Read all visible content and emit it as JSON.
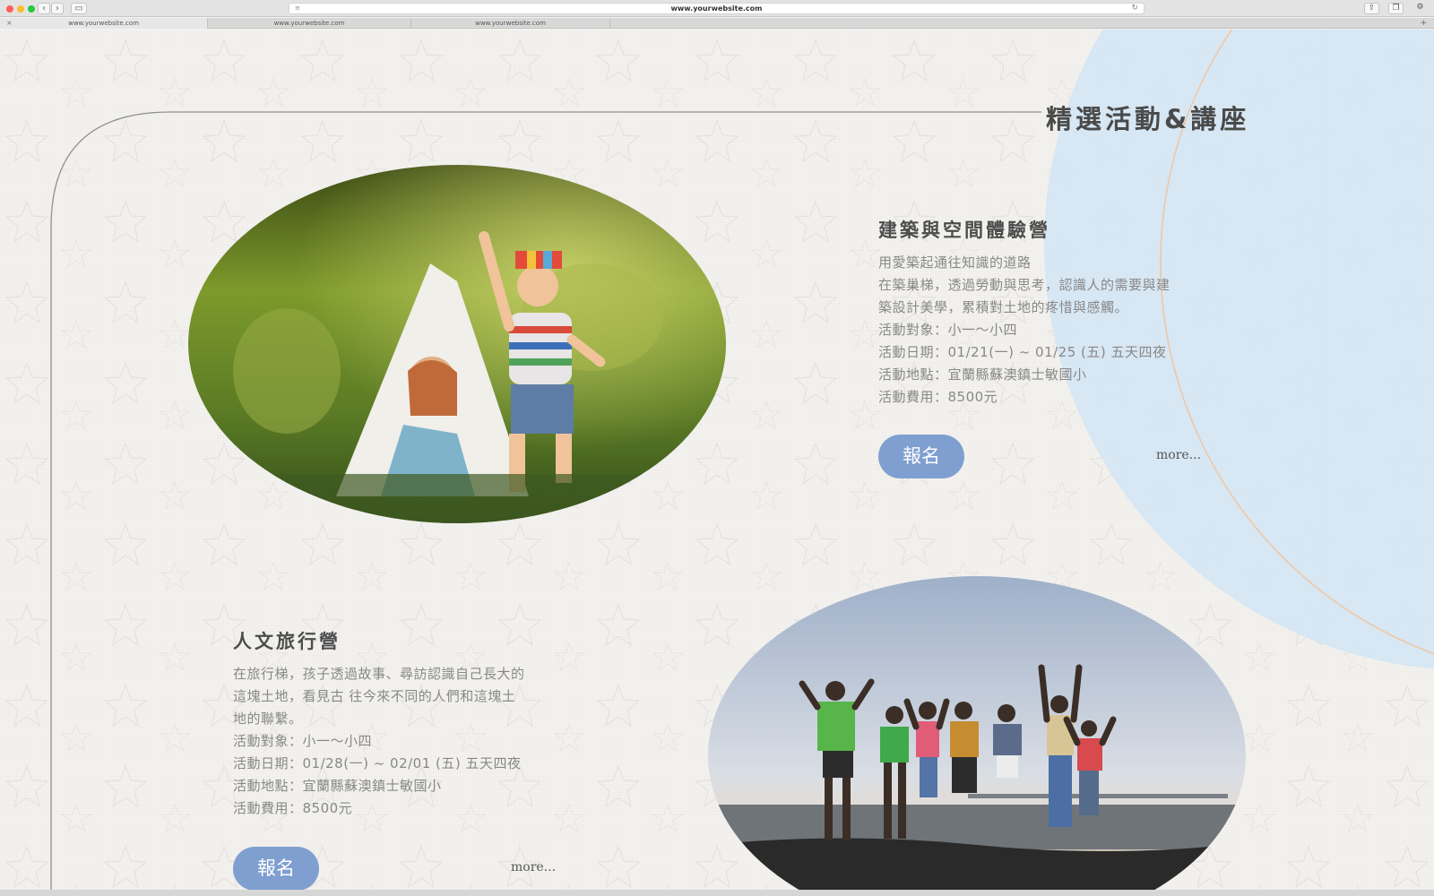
{
  "browser": {
    "url": "www.yourwebsite.com",
    "tabs": [
      "www.yourwebsite.com",
      "www.yourwebsite.com",
      "www.yourwebsite.com"
    ],
    "new_tab": "+",
    "close_tab": "×",
    "back": "‹",
    "forward": "›",
    "colors": {
      "close": "#ff5f57",
      "minimize": "#febc2e",
      "zoom": "#28c840"
    }
  },
  "section": {
    "title": "精選活動&講座"
  },
  "events": [
    {
      "title": "建築與空間體驗營",
      "lines": [
        "用愛築起通往知識的道路",
        "在築巢梯，透過勞動與思考，認識人的需要與建",
        "築設計美學，累積對土地的疼惜與感觸。",
        "活動對象：小一～小四",
        "活動日期：01/21(一) ~ 01/25 (五) 五天四夜",
        "活動地點：宜蘭縣蘇澳鎮士敏國小",
        "活動費用：8500元"
      ],
      "button": "報名",
      "more": "more..."
    },
    {
      "title": "人文旅行營",
      "lines": [
        "在旅行梯，孩子透過故事、尋訪認識自己長大的",
        "這塊土地，看見古 往今來不同的人們和這塊土",
        "地的聯繫。",
        "活動對象：小一～小四",
        "活動日期：01/28(一) ~ 02/01 (五) 五天四夜",
        "活動地點：宜蘭縣蘇澳鎮士敏國小",
        "活動費用：8500元"
      ],
      "button": "報名",
      "more": "more..."
    }
  ],
  "theme": {
    "accent_button": "#7f9fd0",
    "circle_blue": "#d5e6f3",
    "orange_line": "#f0c6a2"
  }
}
